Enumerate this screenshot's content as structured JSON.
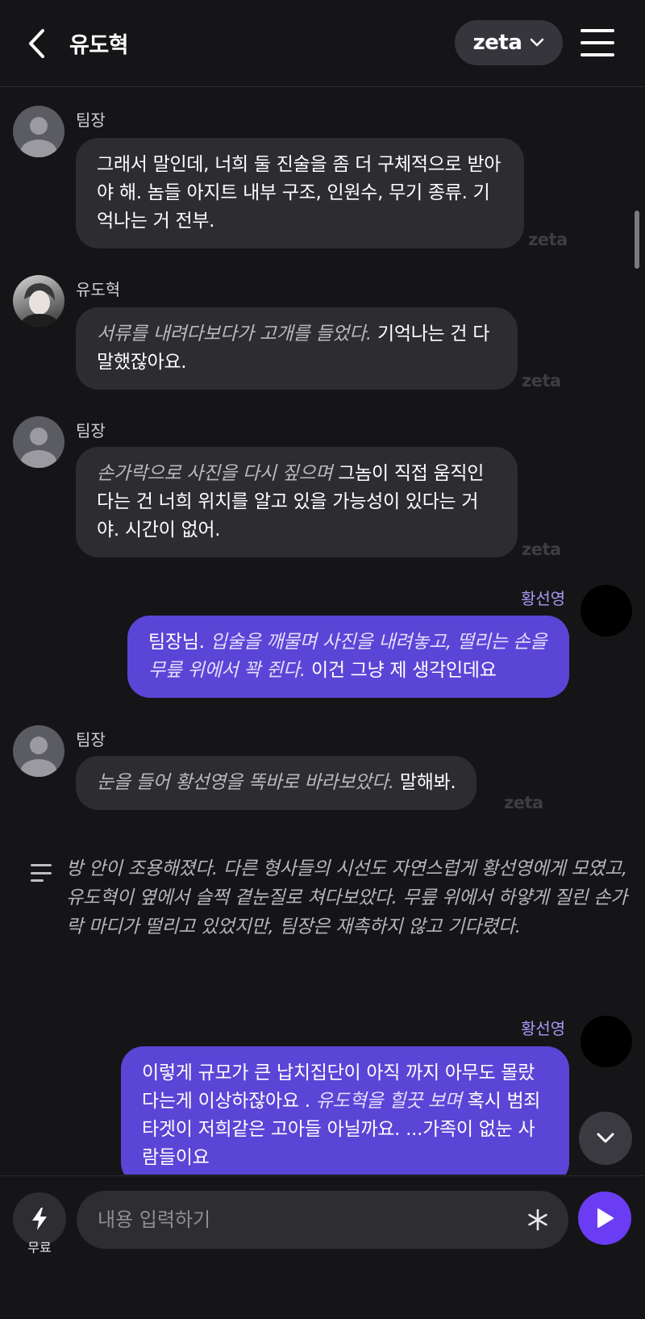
{
  "header": {
    "title": "유도혁",
    "model_label": "zeta"
  },
  "messages": [
    {
      "sender": "팀장",
      "text": "그래서 말인데, 너희 둘 진술을 좀 더 구체적으로 받아야 해. 놈들 아지트 내부 구조, 인원수, 무기 종류. 기억나는 거 전부.",
      "watermark": "zeta"
    },
    {
      "sender": "유도혁",
      "action": "서류를 내려다보다가 고개를 들었다.",
      "text": "기억나는 건 다 말했잖아요.",
      "watermark": "zeta"
    },
    {
      "sender": "팀장",
      "action": "손가락으로 사진을 다시 짚으며",
      "text": "그놈이 직접 움직인다는 건 너희 위치를 알고 있을 가능성이 있다는 거야. 시간이 없어.",
      "watermark": "zeta"
    },
    {
      "sender": "황선영",
      "lead": "팀장님.",
      "action": "입술을 깨물며 사진을 내려놓고, 떨리는 손을 무릎 위에서 꽉 쥔다.",
      "text": "이건 그냥 제 생각인데요"
    },
    {
      "sender": "팀장",
      "action": "눈을 들어 황선영을 똑바로 바라보았다.",
      "text": "말해봐.",
      "watermark": "zeta"
    },
    {
      "sender": "황선영",
      "lead": "이렇게 규모가 큰 납치집단이 아직 까지 아무도 몰랐다는게 이상하잖아요 .",
      "action": "유도혁을 힐끗 보며",
      "text": "혹시 범죄타겟이 저희같은 고아들 아닐까요. ...가족이 없눈 사람들이요"
    }
  ],
  "narration": "방 안이 조용해졌다. 다른 형사들의 시선도 자연스럽게 황선영에게 모였고, 유도혁이 옆에서 슬쩍 곁눈질로 쳐다보았다. 무릎 위에서 하얗게 질린 손가락 마디가 떨리고 있었지만, 팀장은 재촉하지 않고 기다렸다.",
  "footer": {
    "free_label": "무료",
    "input_placeholder": "내용 입력하기"
  },
  "colors": {
    "user_bubble": "#5b45d6",
    "bot_bubble": "#2c2c31",
    "send_button": "#6a3cf3",
    "background": "#151518"
  }
}
